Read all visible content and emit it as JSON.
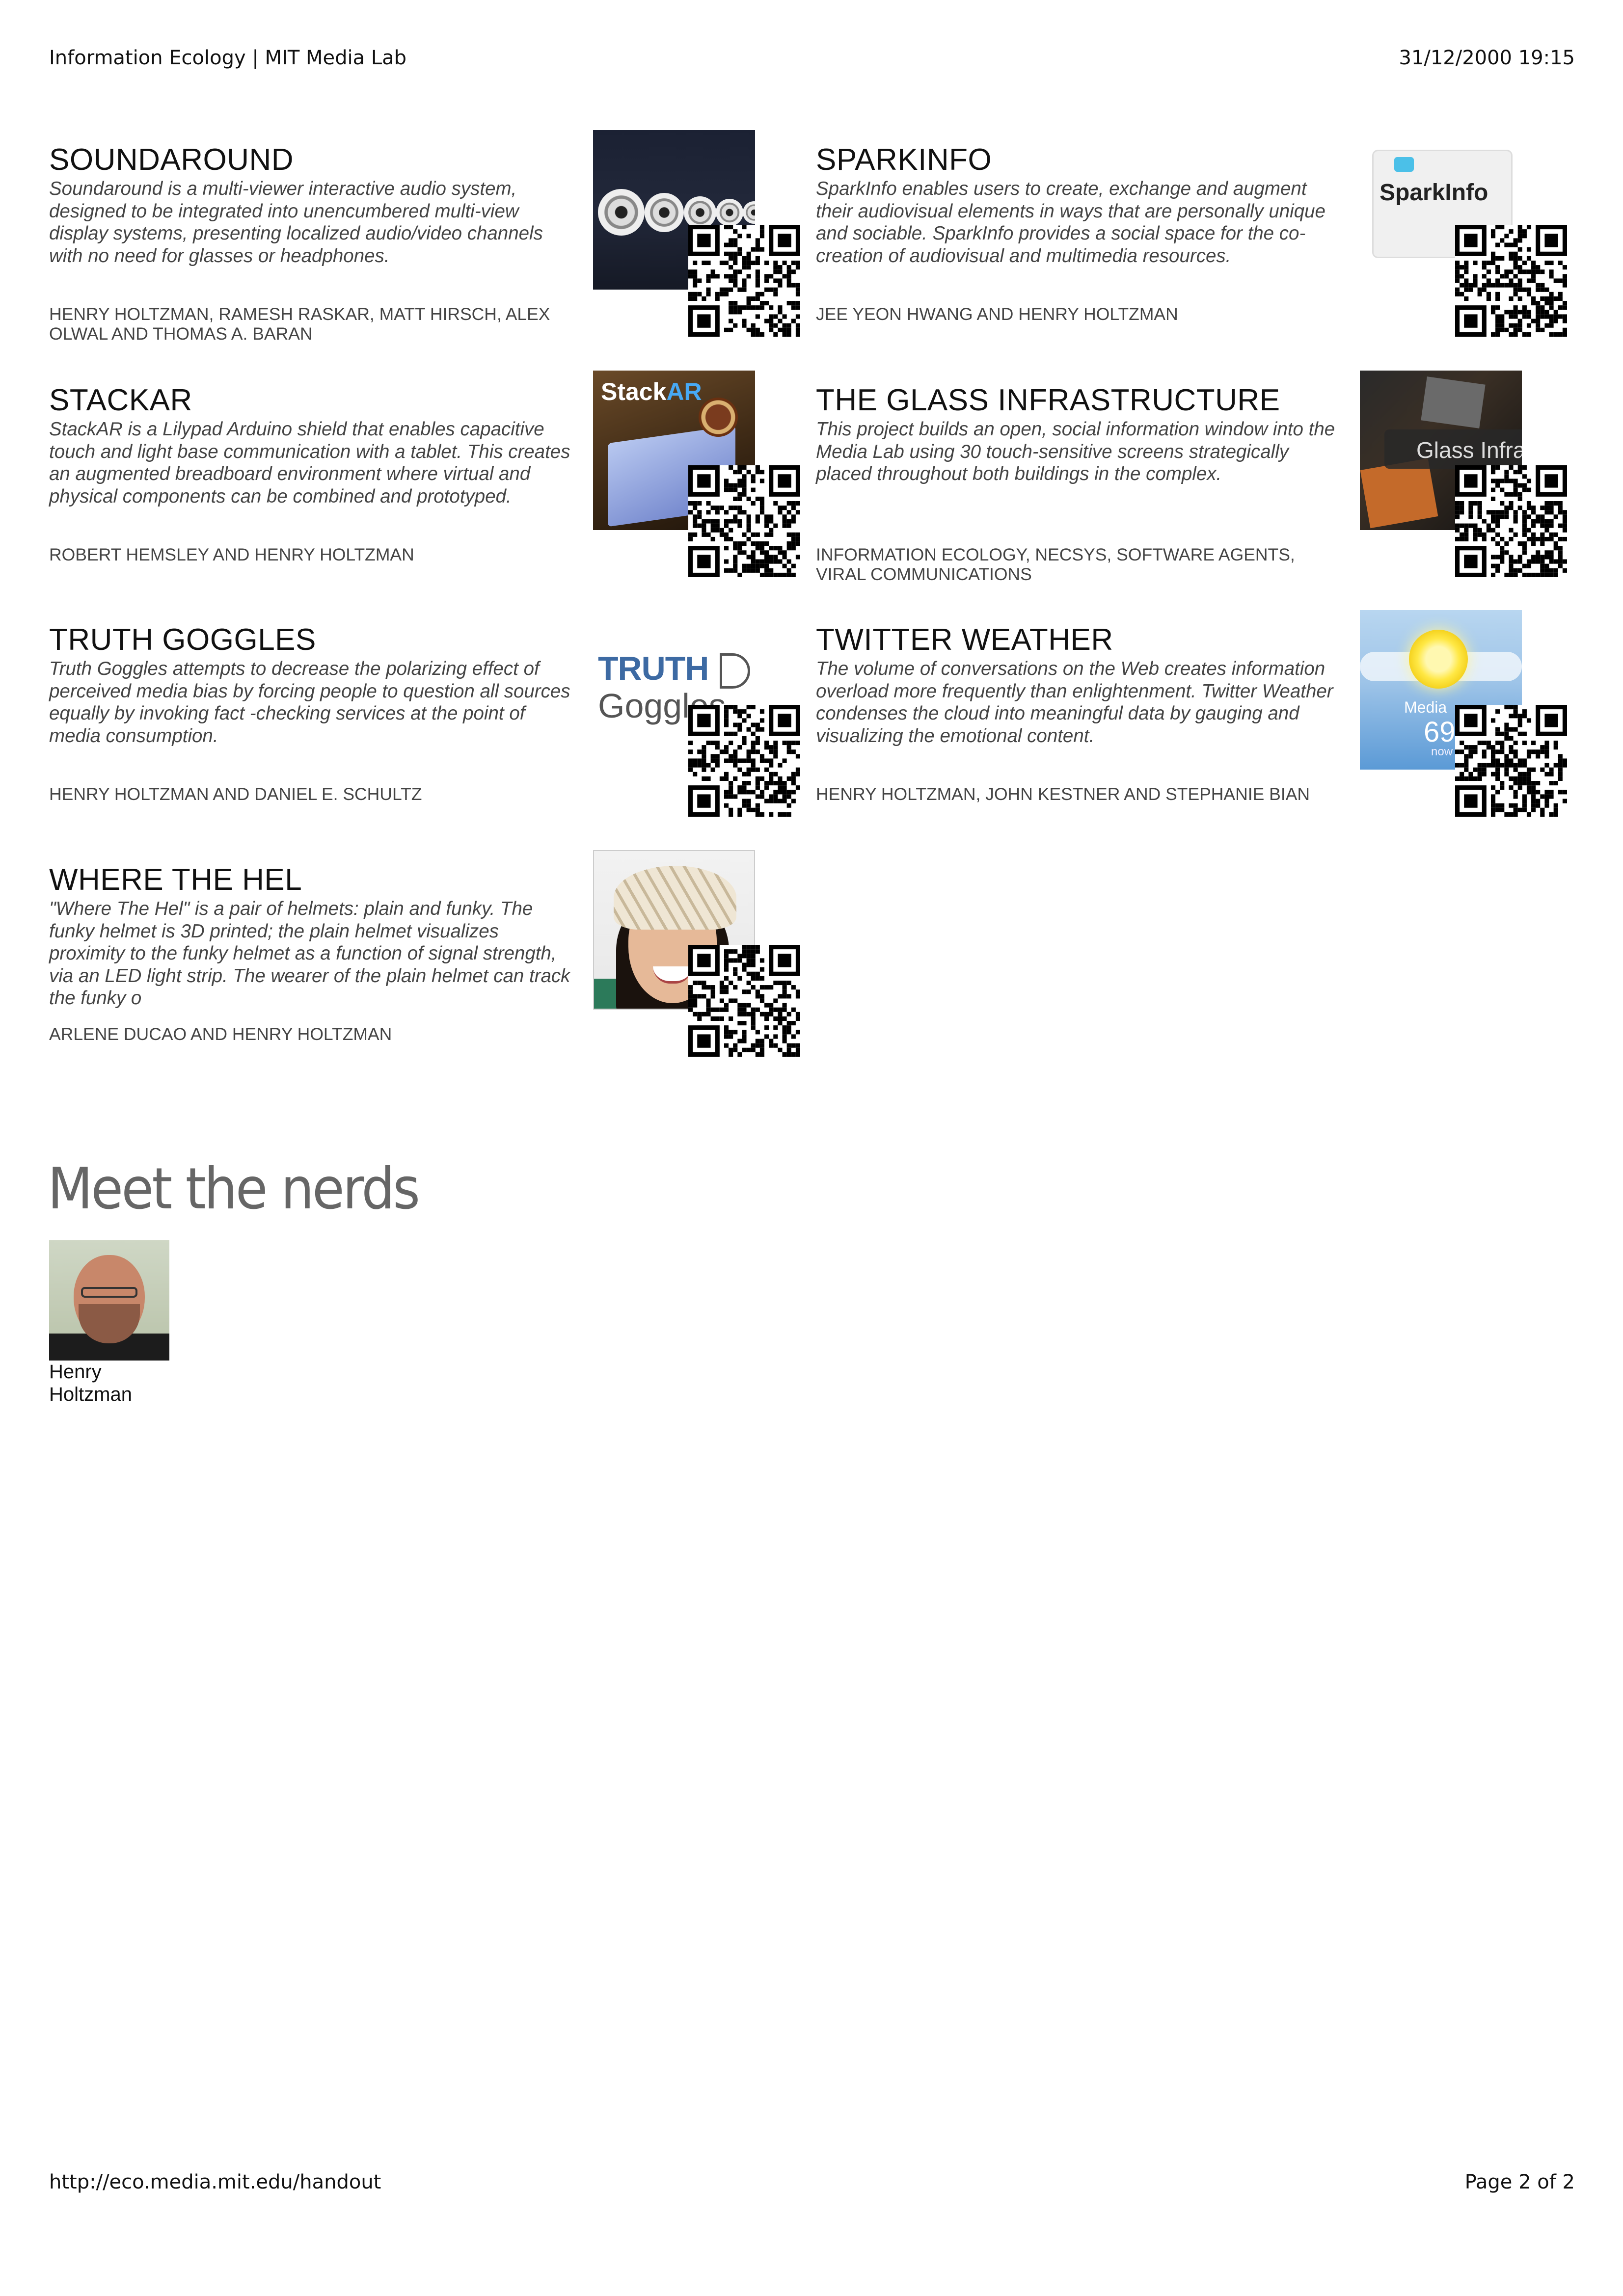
{
  "header": {
    "left": "Information Ecology | MIT Media Lab",
    "right": "31/12/2000 19:15"
  },
  "footer": {
    "left": "http://eco.media.mit.edu/handout",
    "right": "Page 2 of 2"
  },
  "projects": [
    {
      "title": "SOUNDAROUND",
      "description": "Soundaround is a multi-viewer interactive audio system, designed to be integrated into unencumbered multi-view display systems, presenting localized audio/video channels with no need for glasses or headphones.",
      "authors": "HENRY HOLTZMAN, RAMESH RASKAR, MATT HIRSCH, ALEX OLWAL AND THOMAS A. BARAN"
    },
    {
      "title": "SPARKINFO",
      "description": "SparkInfo enables users to create, exchange and augment their audiovisual elements in ways that are personally unique and sociable. SparkInfo provides a social space for the co-creation of audiovisual and multimedia resources.",
      "authors": "JEE YEON HWANG AND HENRY HOLTZMAN",
      "thumb_text": "SparkInfo"
    },
    {
      "title": "STACKAR",
      "description": "StackAR is a Lilypad Arduino shield that enables capacitive touch and light base communication with a tablet. This creates an augmented breadboard environment where virtual and physical components can be combined and prototyped.",
      "authors": "ROBERT HEMSLEY AND HENRY HOLTZMAN",
      "thumb_text_a": "Stack",
      "thumb_text_b": "AR"
    },
    {
      "title": "THE GLASS INFRASTRUCTURE",
      "description": "This project builds an open, social information window into the Media Lab using 30 touch-sensitive screens strategically placed throughout both buildings in the complex.",
      "authors": "INFORMATION ECOLOGY, NECSYS, SOFTWARE AGENTS, VIRAL COMMUNICATIONS",
      "thumb_text": "Glass Infras"
    },
    {
      "title": "TRUTH GOGGLES",
      "description": "Truth Goggles attempts to decrease the polarizing effect of perceived media bias by forcing people to question all sources equally by invoking fact -checking services at the point of media consumption.",
      "authors": "HENRY HOLTZMAN AND DANIEL E. SCHULTZ",
      "thumb_text_a": "TRUTH",
      "thumb_text_b": "Goggles"
    },
    {
      "title": "TWITTER WEATHER",
      "description": "The volume of conversations on the Web creates information overload more frequently than enlightenment. Twitter Weather condenses the cloud into meaningful data by gauging and visualizing the emotional content.",
      "authors": "HENRY HOLTZMAN, JOHN KESTNER AND STEPHANIE BIAN",
      "thumb_text_a": "Media",
      "thumb_text_b": "69",
      "thumb_text_c": "now"
    },
    {
      "title": "WHERE THE HEL",
      "description": "\"Where The Hel\" is a pair of helmets: plain and funky. The funky helmet is 3D printed; the plain helmet visualizes proximity to the funky helmet as a function of signal strength, via an LED light strip. The wearer of the plain helmet can track the funky o",
      "authors": "ARLENE DUCAO AND HENRY HOLTZMAN"
    }
  ],
  "nerds_heading": "Meet the nerds",
  "nerds": [
    {
      "first": "Henry",
      "last": "Holtzman"
    }
  ]
}
